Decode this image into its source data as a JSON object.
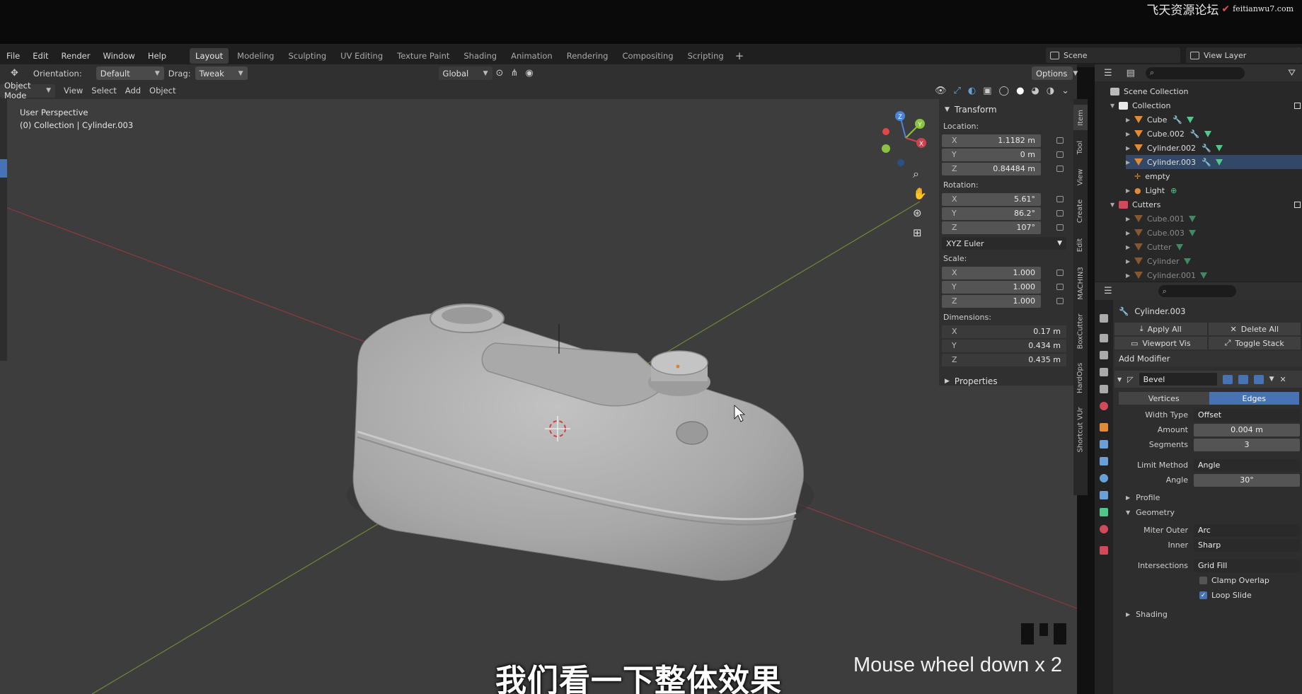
{
  "watermark": {
    "text": "飞天资源论坛",
    "sub": "feitianwu7.com"
  },
  "menubar": {
    "menus": [
      "File",
      "Edit",
      "Render",
      "Window",
      "Help"
    ],
    "workspaces": [
      "Layout",
      "Modeling",
      "Sculpting",
      "UV Editing",
      "Texture Paint",
      "Shading",
      "Animation",
      "Rendering",
      "Compositing",
      "Scripting"
    ],
    "active_workspace": "Layout",
    "plus": "+",
    "scene": "Scene",
    "view_layer": "View Layer"
  },
  "viewport_header": {
    "orientation_label": "Orientation:",
    "orientation_value": "Default",
    "drag_label": "Drag:",
    "drag_value": "Tweak",
    "transform_orientation": "Global",
    "options": "Options",
    "mode": "Object Mode",
    "menus": [
      "View",
      "Select",
      "Add",
      "Object"
    ]
  },
  "viewport": {
    "perspective": "User Perspective",
    "context": "(0) Collection | Cylinder.003",
    "gizmo_axes": [
      "X",
      "Y",
      "Z"
    ]
  },
  "npanel": {
    "transform_title": "Transform",
    "location_label": "Location:",
    "location": [
      {
        "axis": "X",
        "value": "1.1182 m"
      },
      {
        "axis": "Y",
        "value": "0 m"
      },
      {
        "axis": "Z",
        "value": "0.84484 m"
      }
    ],
    "rotation_label": "Rotation:",
    "rotation": [
      {
        "axis": "X",
        "value": "5.61°"
      },
      {
        "axis": "Y",
        "value": "86.2°"
      },
      {
        "axis": "Z",
        "value": "107°"
      }
    ],
    "rotation_mode": "XYZ Euler",
    "scale_label": "Scale:",
    "scale": [
      {
        "axis": "X",
        "value": "1.000"
      },
      {
        "axis": "Y",
        "value": "1.000"
      },
      {
        "axis": "Z",
        "value": "1.000"
      }
    ],
    "dimensions_label": "Dimensions:",
    "dimensions": [
      {
        "axis": "X",
        "value": "0.17 m"
      },
      {
        "axis": "Y",
        "value": "0.434 m"
      },
      {
        "axis": "Z",
        "value": "0.435 m"
      }
    ],
    "properties_title": "Properties"
  },
  "vertical_tabs": [
    "Item",
    "Tool",
    "View",
    "Create",
    "Edit",
    "MACHIN3",
    "BoxCutter",
    "HardOps",
    "Shortcut VUr"
  ],
  "outliner": {
    "scene_collection": "Scene Collection",
    "collection": "Collection",
    "collection_items": [
      "Cube",
      "Cube.002",
      "Cylinder.002",
      "Cylinder.003",
      "empty",
      "Light"
    ],
    "cutters": "Cutters",
    "cutter_items": [
      "Cube.001",
      "Cube.003",
      "Cutter",
      "Cylinder",
      "Cylinder.001"
    ]
  },
  "properties": {
    "object_name": "Cylinder.003",
    "apply_all": "Apply All",
    "delete_all": "Delete All",
    "viewport_vis": "Viewport Vis",
    "toggle_stack": "Toggle Stack",
    "add_modifier": "Add Modifier",
    "modifier_name": "Bevel",
    "seg_vertices": "Vertices",
    "seg_edges": "Edges",
    "width_type_label": "Width Type",
    "width_type": "Offset",
    "amount_label": "Amount",
    "amount": "0.004 m",
    "segments_label": "Segments",
    "segments": "3",
    "limit_method_label": "Limit Method",
    "limit_method": "Angle",
    "angle_label": "Angle",
    "angle": "30°",
    "profile": "Profile",
    "geometry": "Geometry",
    "miter_outer_label": "Miter Outer",
    "miter_outer": "Arc",
    "inner_label": "Inner",
    "inner": "Sharp",
    "intersections_label": "Intersections",
    "intersections": "Grid Fill",
    "clamp_overlap": "Clamp Overlap",
    "loop_slide": "Loop Slide",
    "shading": "Shading"
  },
  "subtitles": {
    "chinese": "我们看一下整体效果",
    "key_event": "Mouse wheel down x 2"
  },
  "colors": {
    "accent": "#4772b3",
    "viewport_bg": "#3d3d3d",
    "object_icon": "#e08a3a",
    "axis_x": "#d0414f",
    "axis_y": "#8bc23f",
    "axis_z": "#4a84d8"
  }
}
